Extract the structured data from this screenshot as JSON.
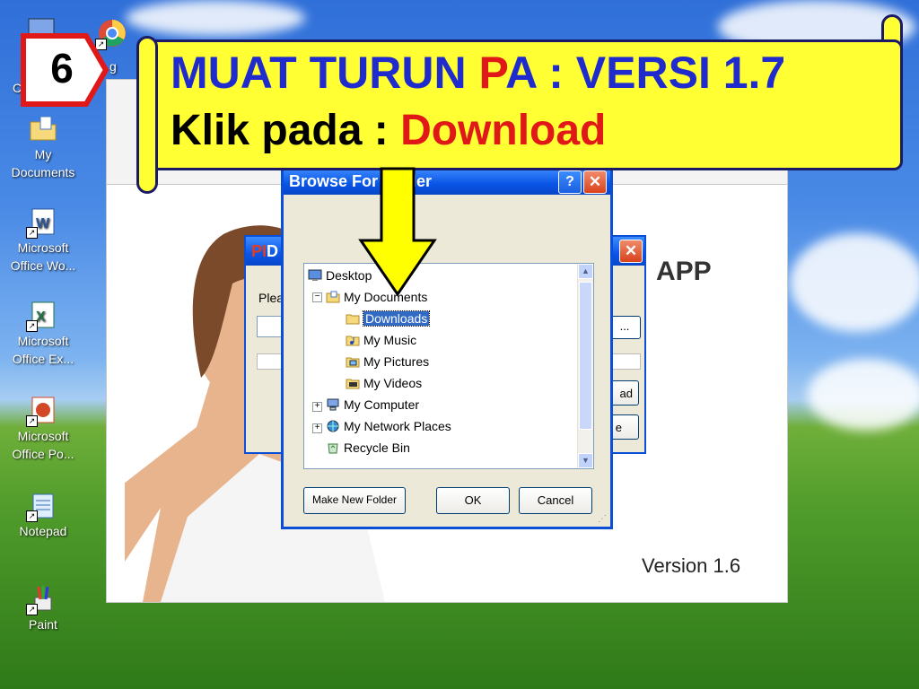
{
  "desktop": {
    "icons": [
      {
        "label": "C",
        "icon": "computer-icon"
      },
      {
        "label": "My Documents",
        "icon": "my-documents-icon"
      },
      {
        "label": "Microsoft Office Wo...",
        "icon": "word-icon"
      },
      {
        "label": "Microsoft Office Ex...",
        "icon": "excel-icon"
      },
      {
        "label": "Microsoft Office Po...",
        "icon": "powerpoint-icon"
      },
      {
        "label": "Notepad",
        "icon": "notepad-icon"
      },
      {
        "label": "Paint",
        "icon": "paint-icon"
      },
      {
        "label": "g",
        "icon": "chrome-icon"
      }
    ]
  },
  "app": {
    "title": "APP",
    "version": "Version 1.6"
  },
  "mid_dialog": {
    "title_prefix": "PI",
    "title_rest": "D",
    "label": "Pleas",
    "button_dots": "...",
    "button_download": "ad",
    "button_close": "e"
  },
  "browse_dialog": {
    "title": "Browse For Folder",
    "help": "?",
    "close": "✕",
    "tree": [
      {
        "label": "Desktop",
        "icon": "desktop-icon",
        "level": 0
      },
      {
        "label": "My Documents",
        "icon": "my-documents-icon",
        "level": 1,
        "expander": "−"
      },
      {
        "label": "Downloads",
        "icon": "folder-icon",
        "level": 2,
        "selected": true
      },
      {
        "label": "My Music",
        "icon": "music-folder-icon",
        "level": 2
      },
      {
        "label": "My Pictures",
        "icon": "pictures-folder-icon",
        "level": 2
      },
      {
        "label": "My Videos",
        "icon": "videos-folder-icon",
        "level": 2
      },
      {
        "label": "My Computer",
        "icon": "computer-icon",
        "level": 1,
        "expander": "+"
      },
      {
        "label": "My Network Places",
        "icon": "network-icon",
        "level": 1,
        "expander": "+"
      },
      {
        "label": "Recycle Bin",
        "icon": "recycle-bin-icon",
        "level": 1
      }
    ],
    "buttons": {
      "new_folder": "Make New Folder",
      "ok": "OK",
      "cancel": "Cancel"
    }
  },
  "overlay": {
    "step_number": "6",
    "line1_a": "MUAT TURUN ",
    "line1_p": "P",
    "line1_b": "A : VERSI 1.7",
    "line2_a": "Klik pada :  ",
    "line2_b": "Download"
  },
  "colors": {
    "banner": "#ffff33",
    "banner_text": "#1f2bcc",
    "highlight": "#e01818",
    "xp_titlebar": "#0a55e6",
    "selection": "#316ac5"
  }
}
